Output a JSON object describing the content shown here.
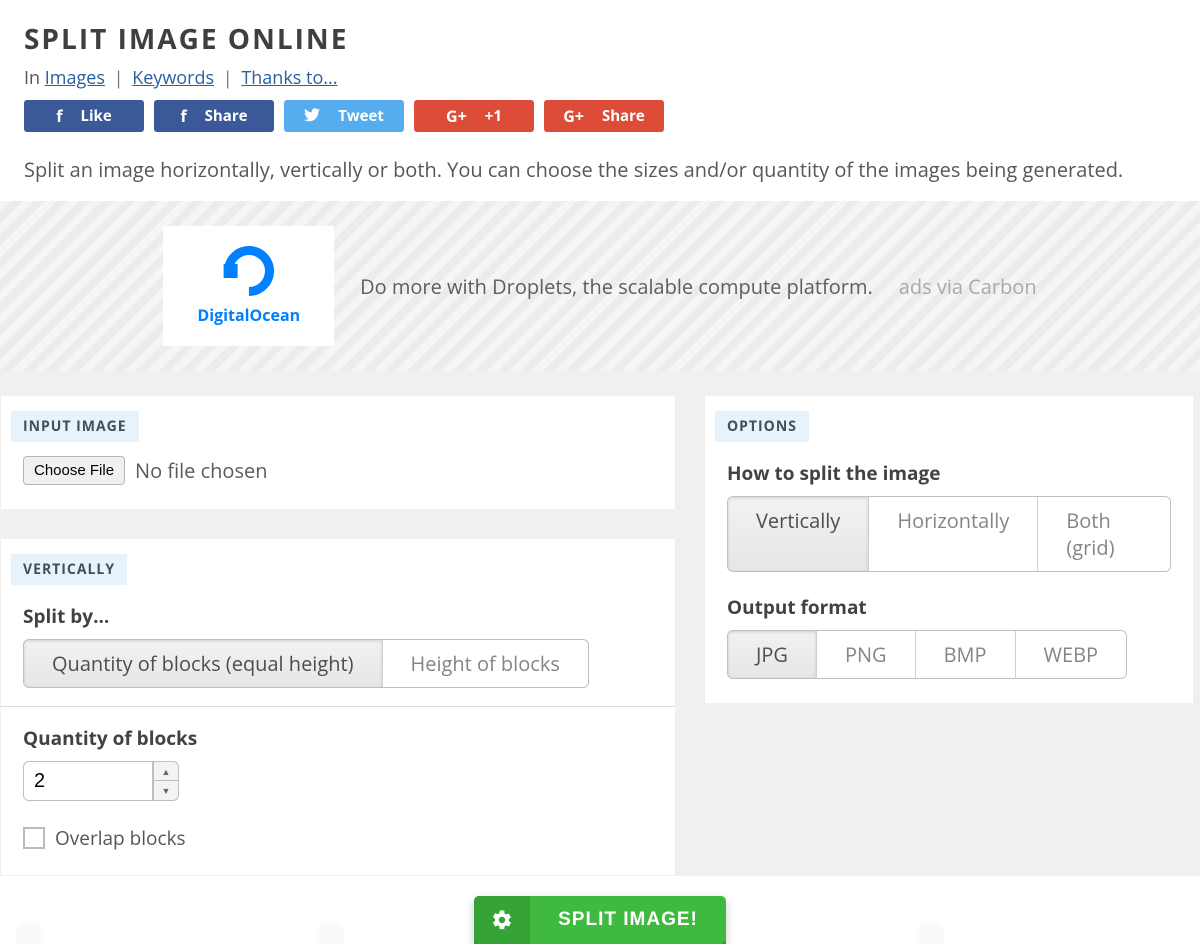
{
  "title": "SPLIT IMAGE ONLINE",
  "breadcrumbs": {
    "prefix": "In",
    "links": [
      "Images",
      "Keywords",
      "Thanks to..."
    ]
  },
  "social": {
    "fb_like": "Like",
    "fb_share": "Share",
    "tweet": "Tweet",
    "gp_plus": "+1",
    "gp_share": "Share"
  },
  "intro": "Split an image horizontally, vertically or both. You can choose the sizes and/or quantity of the images being generated.",
  "ad": {
    "brand": "DigitalOcean",
    "copy": "Do more with Droplets, the scalable compute platform.",
    "disclaimer": "ads via Carbon"
  },
  "input_card": {
    "heading": "INPUT IMAGE",
    "choose_btn": "Choose File",
    "status": "No file chosen"
  },
  "vertical_card": {
    "heading": "VERTICALLY",
    "splitby_label": "Split by...",
    "splitby_options": [
      "Quantity of blocks (equal height)",
      "Height of blocks"
    ],
    "qty_label": "Quantity of blocks",
    "qty_value": "2",
    "overlap_label": "Overlap blocks"
  },
  "options_card": {
    "heading": "OPTIONS",
    "howto_label": "How to split the image",
    "howto_options": [
      "Vertically",
      "Horizontally",
      "Both (grid)"
    ],
    "format_label": "Output format",
    "format_options": [
      "JPG",
      "PNG",
      "BMP",
      "WEBP"
    ]
  },
  "submit": {
    "label": "SPLIT IMAGE!"
  }
}
